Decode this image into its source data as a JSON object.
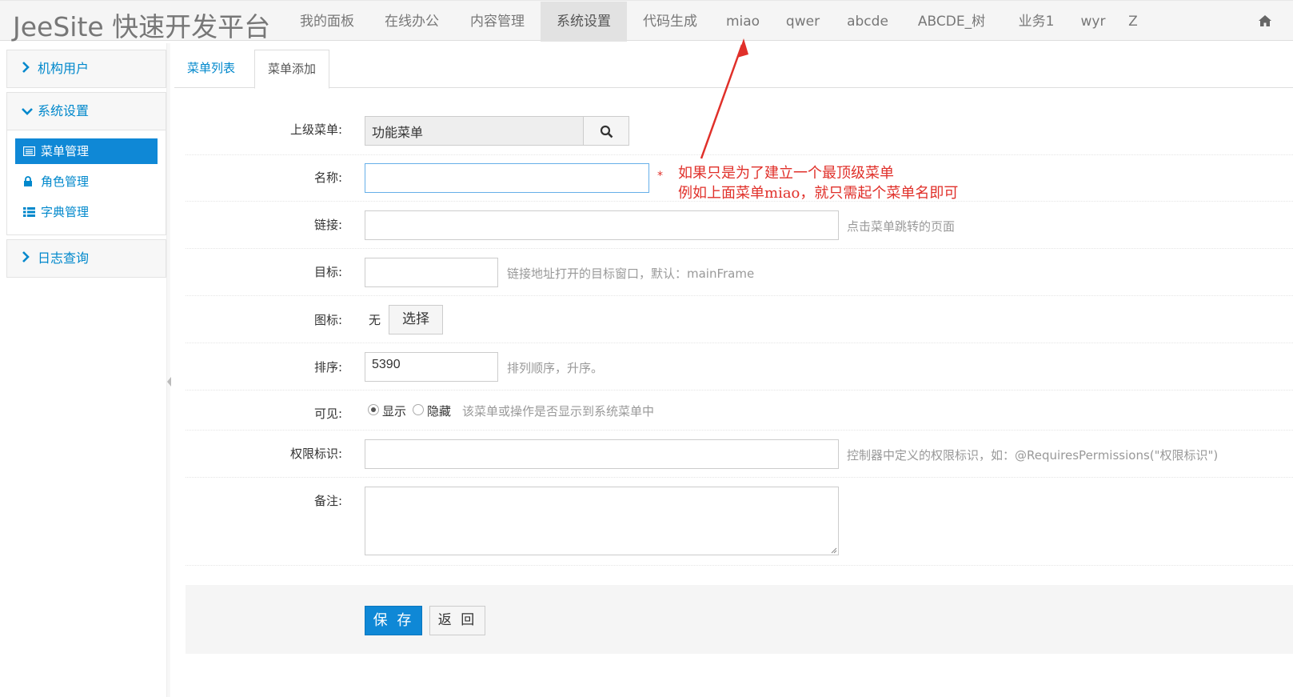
{
  "brand": "JeeSite 快速开发平台",
  "nav": {
    "items": [
      "我的面板",
      "在线办公",
      "内容管理",
      "系统设置",
      "代码生成",
      "miao",
      "qwer",
      "abcde",
      "ABCDE_树",
      "业务1",
      "wyr",
      "Z"
    ],
    "active": "系统设置",
    "home_icon": "home-icon"
  },
  "sidebar": {
    "groups": [
      {
        "label": "机构用户",
        "expanded": false
      },
      {
        "label": "系统设置",
        "expanded": true
      },
      {
        "label": "日志查询",
        "expanded": false
      }
    ],
    "links": [
      {
        "label": "菜单管理",
        "icon": "list-alt-icon",
        "active": true
      },
      {
        "label": "角色管理",
        "icon": "lock-icon",
        "active": false
      },
      {
        "label": "字典管理",
        "icon": "th-list-icon",
        "active": false
      }
    ]
  },
  "tabs": {
    "list": "菜单列表",
    "add": "菜单添加",
    "active": "菜单添加"
  },
  "form": {
    "parent": {
      "label": "上级菜单:",
      "value": "功能菜单",
      "icon": "search-icon"
    },
    "name": {
      "label": "名称:",
      "value": "",
      "required_mark": "*"
    },
    "href": {
      "label": "链接:",
      "value": "",
      "help": "点击菜单跳转的页面"
    },
    "target": {
      "label": "目标:",
      "value": "",
      "help": "链接地址打开的目标窗口，默认：mainFrame"
    },
    "icon": {
      "label": "图标:",
      "value": "无",
      "button": "选择"
    },
    "sort": {
      "label": "排序:",
      "value": "5390",
      "help": "排列顺序，升序。"
    },
    "visible": {
      "label": "可见:",
      "option_show": "显示",
      "option_hide": "隐藏",
      "selected": "显示",
      "help": "该菜单或操作是否显示到系统菜单中"
    },
    "permission": {
      "label": "权限标识:",
      "value": "",
      "help": "控制器中定义的权限标识，如：@RequiresPermissions(\"权限标识\")"
    },
    "remarks": {
      "label": "备注:",
      "value": ""
    }
  },
  "actions": {
    "save": "保 存",
    "back": "返 回"
  },
  "annotation": {
    "line1": "如果只是为了建立一个最顶级菜单",
    "line2": "例如上面菜单miao，就只需起个菜单名即可",
    "color": "#e0302a"
  },
  "colors": {
    "primary": "#0f88d6",
    "link": "#0088cc",
    "annotation": "#e0302a"
  }
}
